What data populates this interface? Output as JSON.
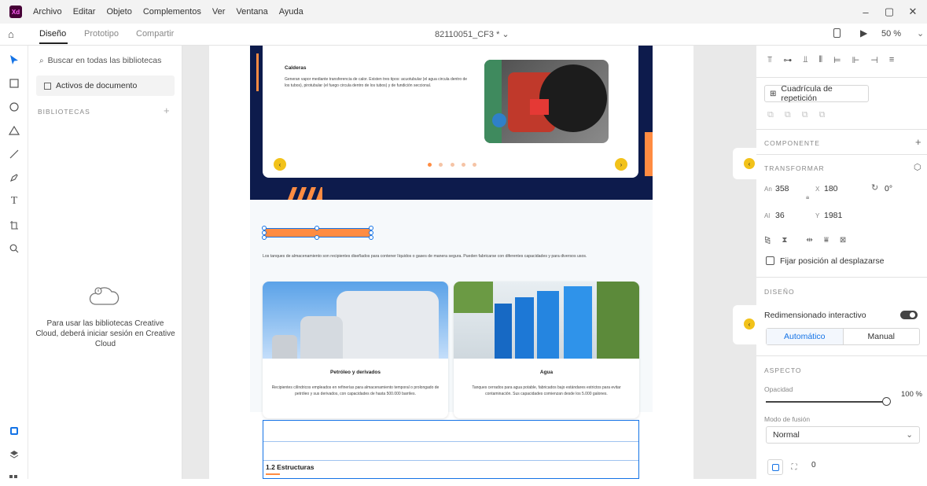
{
  "app": {
    "logo": "Xd"
  },
  "menu": [
    "Archivo",
    "Editar",
    "Objeto",
    "Complementos",
    "Ver",
    "Ventana",
    "Ayuda"
  ],
  "window_controls": {
    "minimize": "–",
    "restore": "▢",
    "close": "✕"
  },
  "toolbar": {
    "tabs": [
      "Diseño",
      "Prototipo",
      "Compartir"
    ],
    "doc_title": "82110051_CF3 * ⌄",
    "zoom": "50 %"
  },
  "library": {
    "search_placeholder": "Buscar en todas las bibliotecas",
    "doc_assets": "Activos de documento",
    "libraries_header": "BIBLIOTECAS",
    "signin_message": "Para usar las bibliotecas Creative Cloud, deberá iniciar sesión en Creative Cloud"
  },
  "artboard": {
    "card_title": "Calderas",
    "card_text": "Generan vapor mediante transferencia de calor. Existen tres tipos: acuotubular (el agua circula dentro de los tubos), pirotubular (el fuego circula dentro de los tubos) y de fundición seccional.",
    "intro_text": "Los tanques de almacenamiento son recipientes diseñados para contener líquidos o gases de manera segura. Pueden fabricarse con diferentes capacidades y para diversos usos.",
    "cards": [
      {
        "title": "Petróleo y derivados",
        "text": "Recipientes cilíndricos empleados en refinerías para almacenamiento temporal o prolongado de petróleo y sus derivados, con capacidades de hasta 500.000 barriles."
      },
      {
        "title": "Agua",
        "text": "Tanques cerrados para agua potable, fabricados bajo estándares estrictos para evitar contaminación. Sus capacidades comienzan desde los 5.000 galones."
      }
    ],
    "section_heading": "1.2 Estructuras"
  },
  "props": {
    "repeat_grid": "Cuadrícula de repetición",
    "component_header": "COMPONENTE",
    "transform_header": "TRANSFORMAR",
    "w_label": "An",
    "w_value": "358",
    "h_label": "Al",
    "h_value": "36",
    "x_label": "X",
    "x_value": "180",
    "y_label": "Y",
    "y_value": "1981",
    "rotation": "0°",
    "fix_position": "Fijar posición al desplazarse",
    "design_header": "DISEÑO",
    "responsive_resize": "Redimensionado interactivo",
    "auto_label": "Automático",
    "manual_label": "Manual",
    "appearance_header": "ASPECTO",
    "opacity_label": "Opacidad",
    "opacity_value": "100 %",
    "blend_label": "Modo de fusión",
    "blend_value": "Normal",
    "corner_value": "0"
  },
  "colors": {
    "accent": "#1473e6",
    "orange": "#ff8c42",
    "navy": "#0d1b4c",
    "yellow": "#f2c21a"
  }
}
